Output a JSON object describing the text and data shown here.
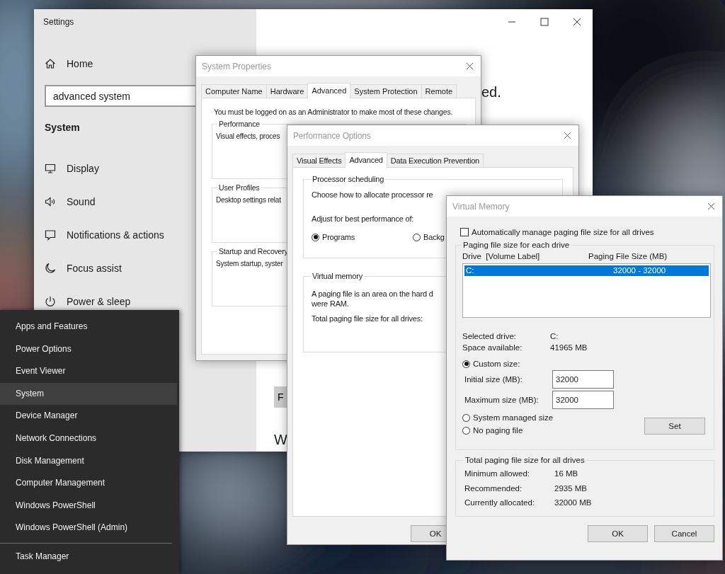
{
  "settings": {
    "title": "Settings",
    "home": "Home",
    "search": {
      "value": "advanced system"
    },
    "section": "System",
    "nav": [
      {
        "label": "Display"
      },
      {
        "label": "Sound"
      },
      {
        "label": "Notifications & actions"
      },
      {
        "label": "Focus assist"
      },
      {
        "label": "Power & sleep"
      }
    ],
    "heading_tail": "ed.",
    "button_fragment": "F",
    "subheading_fragment": "W"
  },
  "start_menu": {
    "items": [
      {
        "label": "Apps and Features",
        "selected": false
      },
      {
        "label": "Power Options",
        "selected": false
      },
      {
        "label": "Event Viewer",
        "selected": false
      },
      {
        "label": "System",
        "selected": true
      },
      {
        "label": "Device Manager",
        "selected": false
      },
      {
        "label": "Network Connections",
        "selected": false
      },
      {
        "label": "Disk Management",
        "selected": false
      },
      {
        "label": "Computer Management",
        "selected": false
      },
      {
        "label": "Windows PowerShell",
        "selected": false
      },
      {
        "label": "Windows PowerShell (Admin)",
        "selected": false
      }
    ],
    "footer_items": [
      {
        "label": "Task Manager",
        "selected": false
      }
    ]
  },
  "system_properties": {
    "title": "System Properties",
    "tabs": [
      {
        "label": "Computer Name",
        "selected": false
      },
      {
        "label": "Hardware",
        "selected": false
      },
      {
        "label": "Advanced",
        "selected": true
      },
      {
        "label": "System Protection",
        "selected": false
      },
      {
        "label": "Remote",
        "selected": false
      }
    ],
    "notice": "You must be logged on as an Administrator to make most of these changes.",
    "groups": [
      {
        "title": "Performance",
        "text": "Visual effects, proces"
      },
      {
        "title": "User Profiles",
        "text": "Desktop settings relat"
      },
      {
        "title": "Startup and Recovery",
        "text": "System startup, syster"
      }
    ]
  },
  "performance_options": {
    "title": "Performance Options",
    "tabs": [
      {
        "label": "Visual Effects",
        "selected": false
      },
      {
        "label": "Advanced",
        "selected": true
      },
      {
        "label": "Data Execution Prevention",
        "selected": false
      }
    ],
    "processor_scheduling": {
      "title": "Processor scheduling",
      "description": "Choose how to allocate processor re",
      "adjust_label": "Adjust for best performance of:",
      "options": [
        {
          "label": "Programs",
          "selected": true
        },
        {
          "label": "Backg",
          "selected": false
        }
      ]
    },
    "virtual_memory": {
      "title": "Virtual memory",
      "description": [
        "A paging file is an area on the hard d",
        "were RAM."
      ],
      "total_label": "Total paging file size for all drives:"
    },
    "buttons": [
      "OK"
    ]
  },
  "virtual_memory": {
    "title": "Virtual Memory",
    "auto_manage": {
      "label": "Automatically manage paging file size for all drives",
      "checked": false
    },
    "drives": {
      "title": "Paging file size for each drive",
      "columns": [
        "Drive  [Volume Label]",
        "Paging File Size (MB)"
      ],
      "rows": [
        {
          "drive": "C:",
          "size": "32000 - 32000",
          "selected": true
        }
      ],
      "selected_drive": {
        "label": "Selected drive:",
        "value": "C:"
      },
      "space_available": {
        "label": "Space available:",
        "value": "41965 MB"
      },
      "size_options": [
        {
          "label": "Custom size:",
          "selected": true
        },
        {
          "label": "System managed size",
          "selected": false
        },
        {
          "label": "No paging file",
          "selected": false
        }
      ],
      "initial_size": {
        "label": "Initial size (MB):",
        "value": "32000"
      },
      "maximum_size": {
        "label": "Maximum size (MB):",
        "value": "32000"
      },
      "set_button": "Set"
    },
    "totals": {
      "title": "Total paging file size for all drives",
      "rows": [
        {
          "label": "Minimum allowed:",
          "value": "16 MB"
        },
        {
          "label": "Recommended:",
          "value": "2935 MB"
        },
        {
          "label": "Currently allocated:",
          "value": "32000 MB"
        }
      ]
    },
    "buttons": [
      "OK",
      "Cancel"
    ]
  }
}
